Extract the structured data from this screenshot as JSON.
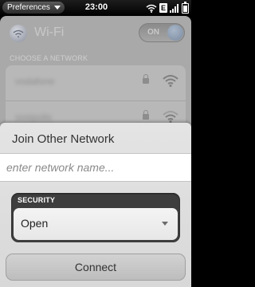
{
  "status_bar": {
    "app_menu_label": "Preferences",
    "time": "23:00",
    "network_badge": "E",
    "icons": [
      "wifi-icon",
      "signal-icon",
      "battery-icon"
    ]
  },
  "background_app": {
    "title": "Wi-Fi",
    "toggle_label": "ON",
    "section_header": "CHOOSE A NETWORK",
    "networks": [
      {
        "name": "vodafone",
        "secured": true
      },
      {
        "name": "sosipolis",
        "secured": true
      }
    ]
  },
  "sheet": {
    "title": "Join Other Network",
    "network_name_placeholder": "enter network name...",
    "security_label": "SECURITY",
    "security_value": "Open",
    "connect_label": "Connect"
  }
}
